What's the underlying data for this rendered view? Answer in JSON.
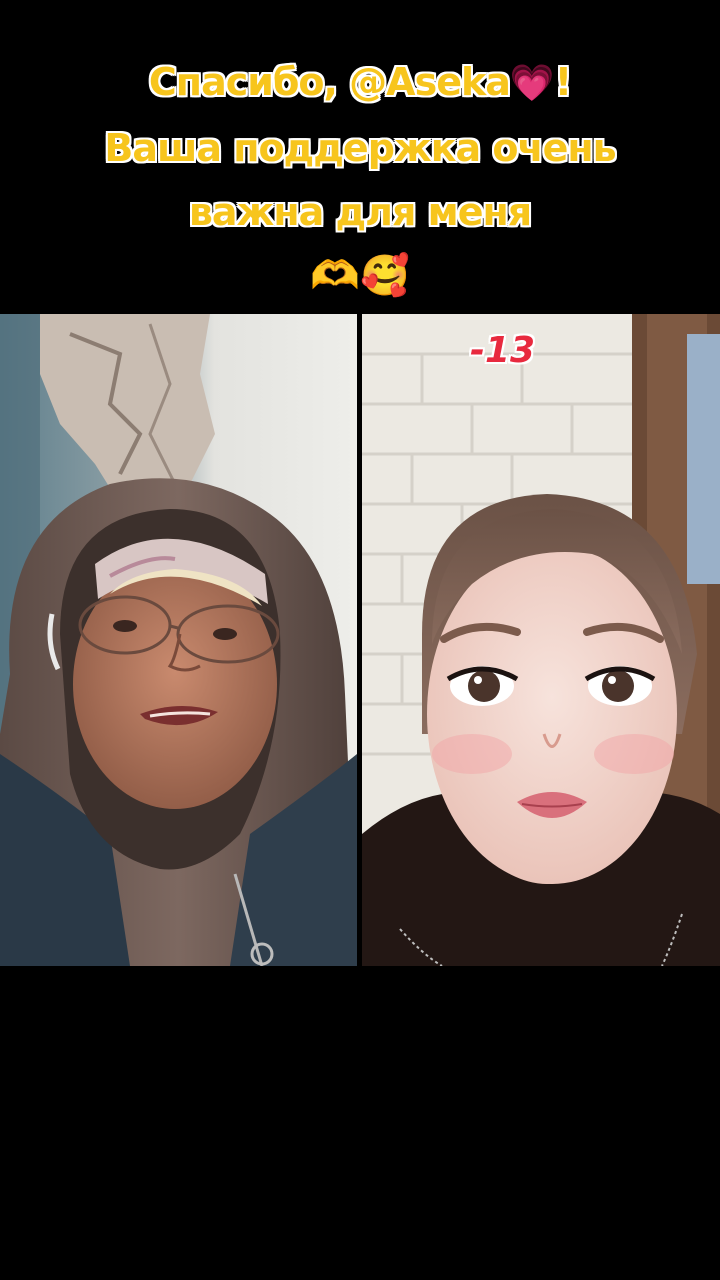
{
  "banner": {
    "line1_prefix": "Спасибо, @Aseka",
    "line1_heart": "💗",
    "line1_suffix": "!",
    "line2": "Ваша поддержка очень",
    "line3": "важна для меня",
    "emojis": "🫶🥰"
  },
  "stream": {
    "counter": "-13"
  },
  "colors": {
    "banner_text": "#f7c51d",
    "counter_text": "#e8293e",
    "background": "#000000"
  }
}
